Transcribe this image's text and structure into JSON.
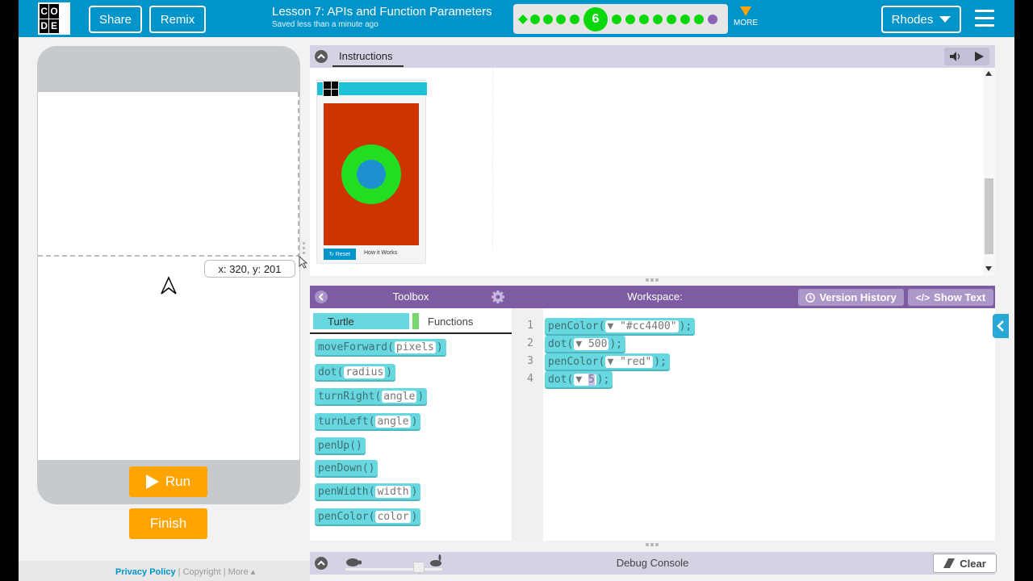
{
  "header": {
    "logo_letters": [
      "C",
      "O",
      "D",
      "E"
    ],
    "share_label": "Share",
    "remix_label": "Remix",
    "lesson_title": "Lesson 7: APIs and Function Parameters",
    "saved_status": "Saved less than a minute ago",
    "progress_current": "6",
    "more_label": "MORE",
    "user_label": "Rhodes"
  },
  "visualization": {
    "coordinate_readout": "x: 320, y: 201",
    "run_label": "Run",
    "finish_label": "Finish"
  },
  "footer": {
    "privacy": "Privacy Policy",
    "sep1": "|",
    "copyright": "Copyright",
    "sep2": "|",
    "more": "More ▴"
  },
  "instructions": {
    "title": "Instructions",
    "preview": {
      "reset_label": "Reset",
      "how_label": "How it Works",
      "background_color": "#cc3300",
      "ring_color": "#22dd22",
      "center_color": "#1e90d0"
    }
  },
  "toolbox": {
    "title": "Toolbox",
    "tab_turtle": "Turtle",
    "tab_functions": "Functions",
    "blocks": [
      {
        "name": "moveForward",
        "arg": "pixels"
      },
      {
        "name": "dot",
        "arg": "radius"
      },
      {
        "name": "turnRight",
        "arg": "angle"
      },
      {
        "name": "turnLeft",
        "arg": "angle"
      },
      {
        "name": "penUp",
        "arg": ""
      },
      {
        "name": "penDown",
        "arg": ""
      },
      {
        "name": "penWidth",
        "arg": "width"
      },
      {
        "name": "penColor",
        "arg": "color"
      }
    ]
  },
  "workspace": {
    "title": "Workspace:",
    "version_history_label": "Version History",
    "show_text_label": "Show Text",
    "lines": [
      {
        "num": "1",
        "fn": "penColor",
        "arg": "\"#cc4400\""
      },
      {
        "num": "2",
        "fn": "dot",
        "arg": "500"
      },
      {
        "num": "3",
        "fn": "penColor",
        "arg": "\"red\""
      },
      {
        "num": "4",
        "fn": "dot",
        "arg": "5"
      }
    ]
  },
  "debug": {
    "title": "Debug Console",
    "clear_label": "Clear"
  },
  "colors": {
    "header": "#0094ca",
    "toolbox_header": "#7e5ca2",
    "block": "#68d8e0",
    "run_button": "#ffa400",
    "progress_dot": "#0bd80b"
  }
}
